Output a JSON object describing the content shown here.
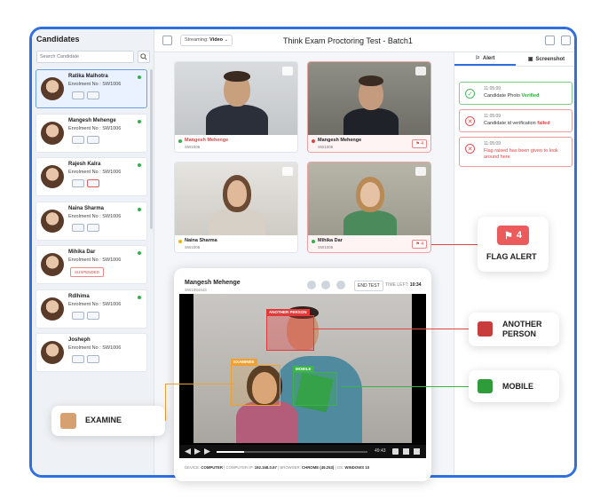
{
  "sidebar": {
    "title": "Candidates",
    "search_placeholder": "Search Candidate",
    "items": [
      {
        "name": "Ratika Malhotra",
        "enrolment": "Enrolment No : SW1006"
      },
      {
        "name": "Mangesh Mehenge",
        "enrolment": "Enrolment No : SW1006"
      },
      {
        "name": "Rajesh Kalra",
        "enrolment": "Enrolment No : SW1006"
      },
      {
        "name": "Naina Sharma",
        "enrolment": "Enrolment No : SW1006"
      },
      {
        "name": "Mihika Dar",
        "enrolment": "Enrolment No : SW1006",
        "badge": "SUSPENDED"
      },
      {
        "name": "Rdlhima",
        "enrolment": "Enrolment No : SW1006"
      },
      {
        "name": "Josheph",
        "enrolment": "Enrolment No : SW1006"
      }
    ]
  },
  "header": {
    "streaming_label": "Streaming:",
    "streaming_value": "Video",
    "title": "Think Exam Proctoring Test - Batch1"
  },
  "right_panel": {
    "tabs": [
      "Alert",
      "Screenshot"
    ],
    "alerts": [
      {
        "time": "11:05:09",
        "text_before": "Candidate Photo ",
        "highlight": "Verified"
      },
      {
        "time": "11:05:09",
        "text_before": "Candidate id verification ",
        "highlight": "failed"
      },
      {
        "time": "11:05:09",
        "text": "Flag raised has been given to look around here"
      }
    ]
  },
  "tiles": [
    {
      "name": "Mangesh Mehenge",
      "enrolment": "SW1006",
      "flag": "",
      "status_color": "#2cb34a"
    },
    {
      "name": "Mangesh Mehenge",
      "enrolment": "SW1006",
      "flag": "4",
      "status_color": "#e04545"
    },
    {
      "name": "Naina Sharma",
      "enrolment": "SW1006",
      "flag": "",
      "status_color": "#f0b400"
    },
    {
      "name": "Mihika Dar",
      "enrolment": "SW1006",
      "flag": "4",
      "status_color": "#2cb34a"
    }
  ],
  "main_video": {
    "name": "Mangesh Mehenge",
    "enrolment": "SW1094443",
    "end_test": "END TEST",
    "time_left_label": "TIME LEFT:",
    "time_left": "10:34",
    "elapsed": "49:43",
    "progress": 0.18,
    "box_labels": {
      "another": "ANOTHER PERSON",
      "examinee": "EXAMINEE",
      "mobile": "MOBILE"
    },
    "footer": {
      "device_label": "DEVICE:",
      "device": "COMPUTER",
      "ip_label": "COMPUTER IP:",
      "ip": "192.168.0.67",
      "browser_label": "BROWSER:",
      "browser": "CHROME (49.253)",
      "os_label": "OS:",
      "os": "WINDOWS 10"
    }
  },
  "callouts": {
    "flag_count": "4",
    "flag_alert": "FLAG ALERT",
    "another_person_1": "ANOTHER",
    "another_person_2": "PERSON",
    "mobile": "MOBILE",
    "examine": "EXAMINE"
  },
  "colors": {
    "accent": "#2f6fe0",
    "alert_red": "#e04545",
    "ok_green": "#2cb34a",
    "examinee_orange": "#f0a030",
    "mobile_green": "#3cb34a"
  }
}
